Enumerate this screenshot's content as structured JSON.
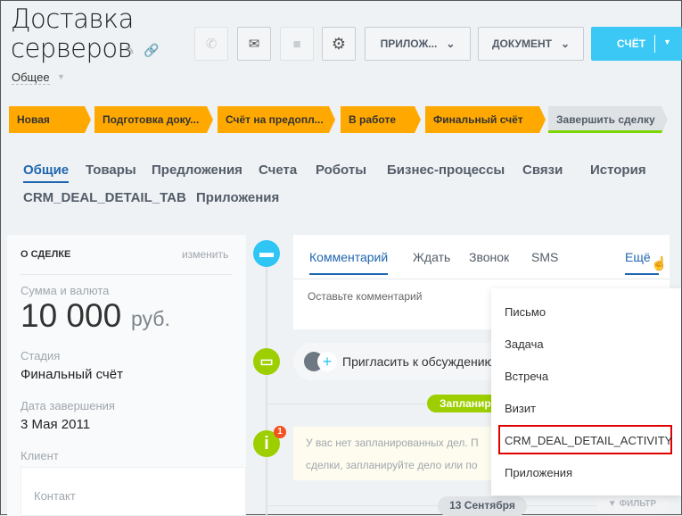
{
  "header": {
    "title_line1": "Доставка",
    "title_line2": "серверов",
    "category": "Общее"
  },
  "toolbar": {
    "apps": "ПРИЛОЖ...",
    "document": "ДОКУМЕНТ",
    "invoice": "СЧЁТ"
  },
  "stages": [
    "Новая",
    "Подготовка доку...",
    "Счёт на предопл...",
    "В работе",
    "Финальный счёт",
    "Завершить сделку"
  ],
  "tabs_row1": [
    "Общие",
    "Товары",
    "Предложения",
    "Счета",
    "Роботы",
    "Бизнес-процессы",
    "Связи",
    "История"
  ],
  "tabs_row2": [
    "CRM_DEAL_DETAIL_TAB",
    "Приложения"
  ],
  "deal": {
    "heading": "О СДЕЛКЕ",
    "edit": "изменить",
    "amount_label": "Сумма и валюта",
    "amount": "10 000",
    "currency": "руб.",
    "stage_label": "Стадия",
    "stage": "Финальный счёт",
    "date_label": "Дата завершения",
    "date": "3 Мая 2011",
    "client_label": "Клиент",
    "contact": "Контакт"
  },
  "activity": {
    "tabs": [
      "Комментарий",
      "Ждать",
      "Звонок",
      "SMS"
    ],
    "more": "Ещё",
    "placeholder": "Оставьте комментарий",
    "invite": "Пригласить к обсуждению",
    "planned": "Запланированные",
    "empty_line1": "У вас нет запланированных дел. П",
    "empty_line2": "сделки, запланируйте дело или по",
    "badge": "1",
    "date": "13 Сентября",
    "filter": "ФИЛЬТР"
  },
  "menu": [
    "Письмо",
    "Задача",
    "Встреча",
    "Визит",
    "CRM_DEAL_DETAIL_ACTIVITY",
    "Приложения"
  ],
  "colors": {
    "accent": "#3bc8f5",
    "stage": "#ffa900",
    "green": "#9dcf00",
    "highlight": "#e00000"
  }
}
